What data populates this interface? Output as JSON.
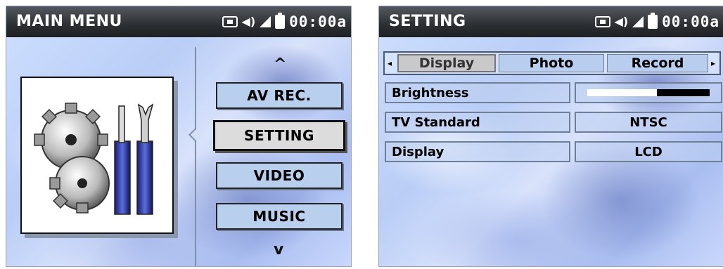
{
  "main_menu": {
    "title": "MAIN MENU",
    "clock": "00:00a",
    "app_icon": "settings-tools-icon",
    "up_arrow": "^",
    "down_arrow": "v",
    "items": [
      {
        "label": "AV REC.",
        "selected": false
      },
      {
        "label": "SETTING",
        "selected": true
      },
      {
        "label": "VIDEO",
        "selected": false
      },
      {
        "label": "MUSIC",
        "selected": false
      }
    ]
  },
  "setting": {
    "title": "SETTING",
    "clock": "00:00a",
    "tabs": [
      {
        "label": "Display",
        "active": true
      },
      {
        "label": "Photo",
        "active": false
      },
      {
        "label": "Record",
        "active": false
      }
    ],
    "rows": {
      "brightness": {
        "label": "Brightness",
        "level": 0.57
      },
      "tv_standard": {
        "label": "TV Standard",
        "value": "NTSC"
      },
      "display": {
        "label": "Display",
        "value": "LCD"
      }
    }
  },
  "colors": {
    "titlebar": "#2c2f33",
    "button": "#b8cfee",
    "selected_button": "#dcdcdc"
  }
}
